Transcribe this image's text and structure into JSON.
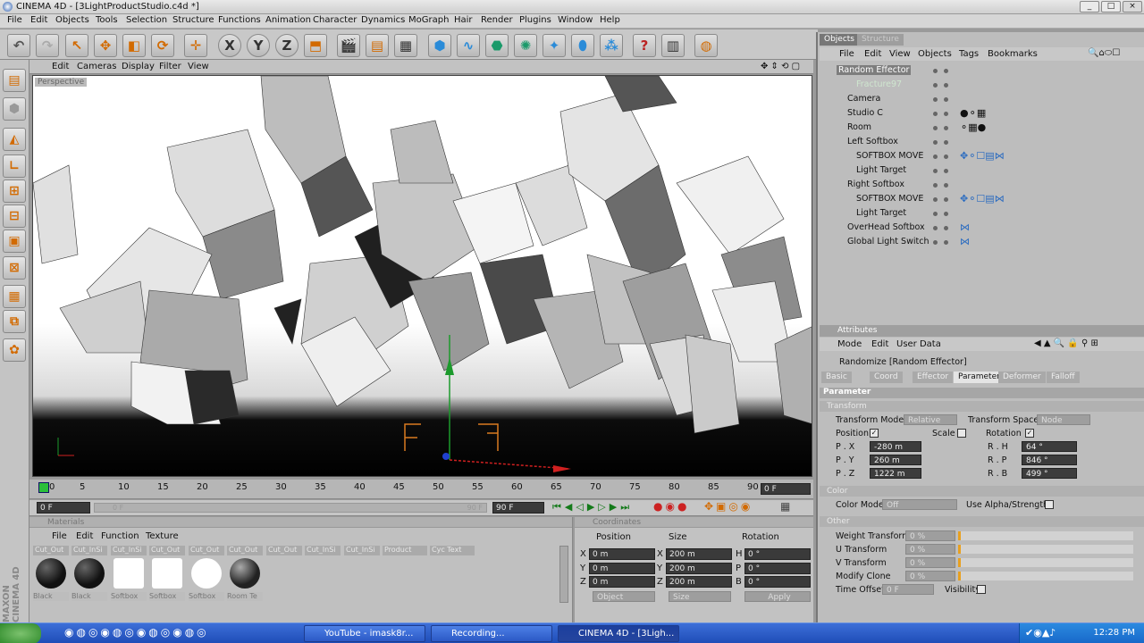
{
  "window": {
    "title": "CINEMA 4D - [3LightProductStudio.c4d *]"
  },
  "menubar": [
    "File",
    "Edit",
    "Objects",
    "Tools",
    "Selection",
    "Structure",
    "Functions",
    "Animation",
    "Character",
    "Dynamics",
    "MoGraph",
    "Hair",
    "Render",
    "Plugins",
    "Window",
    "Help"
  ],
  "viewport": {
    "menu": [
      "Edit",
      "Cameras",
      "Display",
      "Filter",
      "View"
    ],
    "label": "Perspective"
  },
  "timeline": {
    "ticks": [
      "0",
      "5",
      "10",
      "15",
      "20",
      "25",
      "30",
      "35",
      "40",
      "45",
      "50",
      "55",
      "60",
      "65",
      "70",
      "75",
      "80",
      "85",
      "90"
    ],
    "current_frame": "0 F",
    "start_frame": "0 F",
    "range_label": "0 F",
    "range_end": "90 F",
    "end_frame": "90 F"
  },
  "materials": {
    "header": "Materials",
    "menu": [
      "File",
      "Edit",
      "Function",
      "Texture"
    ],
    "tabs": [
      "Cut_Out",
      "Cut_InSi",
      "Cut_InSi",
      "Cut_Out",
      "Cut_Out",
      "Cut_Out",
      "Cut_Out",
      "Cut_InSi",
      "Cut_InSi",
      "Product",
      "Cyc Text"
    ],
    "items": [
      {
        "label": "Black",
        "color": "#111111"
      },
      {
        "label": "Black",
        "color": "#111111"
      },
      {
        "label": "Softbox",
        "color": "#ffffff"
      },
      {
        "label": "Softbox",
        "color": "#ffffff"
      },
      {
        "label": "Softbox",
        "color": "#ffffff"
      },
      {
        "label": "Room Te",
        "color": "#222222"
      }
    ]
  },
  "coordinates": {
    "header": "Coordinates",
    "cols": [
      "Position",
      "Size",
      "Rotation"
    ],
    "rows": [
      {
        "axis": "X",
        "pos": "0 m",
        "size_axis": "X",
        "size": "200 m",
        "rot_axis": "H",
        "rot": "0 °"
      },
      {
        "axis": "Y",
        "pos": "0 m",
        "size_axis": "Y",
        "size": "200 m",
        "rot_axis": "P",
        "rot": "0 °"
      },
      {
        "axis": "Z",
        "pos": "0 m",
        "size_axis": "Z",
        "size": "200 m",
        "rot_axis": "B",
        "rot": "0 °"
      }
    ],
    "mode": "Object",
    "size_mode": "Size",
    "apply": "Apply"
  },
  "objects": {
    "tabs": [
      "Objects",
      "Structure"
    ],
    "menu": [
      "File",
      "Edit",
      "View",
      "Objects",
      "Tags",
      "Bookmarks"
    ],
    "items": [
      "Random Effector",
      "Fracture97",
      "Camera",
      "Studio C",
      "Room",
      "Left Softbox",
      "SOFTBOX MOVE",
      "Light Target",
      "Right Softbox",
      "SOFTBOX MOVE",
      "Light Target",
      "OverHead Softbox",
      "Global Light Switch"
    ]
  },
  "attributes": {
    "header": "Attributes",
    "menu": [
      "Mode",
      "Edit",
      "User Data"
    ],
    "object": "Randomize [Random Effector]",
    "tabs": [
      "Basic",
      "Coord",
      "Effector",
      "Parameter",
      "Deformer",
      "Falloff"
    ],
    "section": "Parameter",
    "transform_header": "Transform",
    "transform_mode_label": "Transform Mode",
    "transform_mode": "Relative",
    "transform_space_label": "Transform Space",
    "transform_space": "Node",
    "position_label": "Position",
    "scale_label": "Scale",
    "rotation_label": "Rotation",
    "px": "-280 m",
    "py": "260 m",
    "pz": "1222 m",
    "rh": "64 °",
    "rp": "846 °",
    "rb": "499 °",
    "px_label": "P . X",
    "py_label": "P . Y",
    "pz_label": "P . Z",
    "rh_label": "R . H",
    "rp_label": "R . P",
    "rb_label": "R . B",
    "color_header": "Color",
    "color_mode_label": "Color Mode",
    "color_mode": "Off",
    "use_alpha": "Use Alpha/Strength",
    "other_header": "Other",
    "weight": "Weight Transform",
    "u_transform": "U Transform",
    "v_transform": "V Transform",
    "modify_clone": "Modify Clone",
    "pct": "0 %",
    "time_offset": "Time Offset",
    "time_val": "0 F",
    "visibility": "Visibility"
  },
  "taskbar": {
    "tasks": [
      "YouTube - imask8r...",
      "Recording...",
      "CINEMA 4D - [3Ligh..."
    ],
    "clock": "12:28 PM"
  }
}
